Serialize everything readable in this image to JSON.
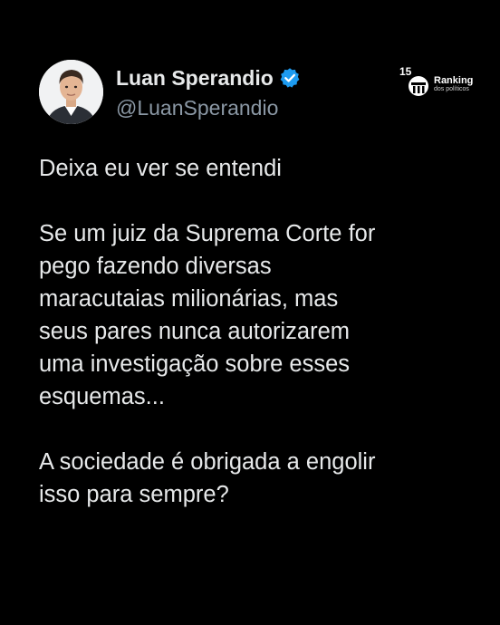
{
  "author": {
    "display_name": "Luan Sperandio",
    "handle": "@LuanSperandio",
    "verified_color": "#1d9bf0"
  },
  "watermark": {
    "badge_number": "15",
    "title": "Ranking",
    "subtitle": "dos políticos"
  },
  "tweet": {
    "paragraphs": [
      "Deixa eu ver se entendi",
      "Se um juiz da Suprema Corte for\npego fazendo diversas\nmaracutaias milionárias, mas\nseus pares nunca autorizarem\numa investigação sobre esses\nesquemas...",
      "A sociedade é obrigada a engolir\nisso para sempre?"
    ]
  },
  "colors": {
    "background": "#000000",
    "text": "#e7e9ea",
    "secondary_text": "#8b98a5"
  }
}
